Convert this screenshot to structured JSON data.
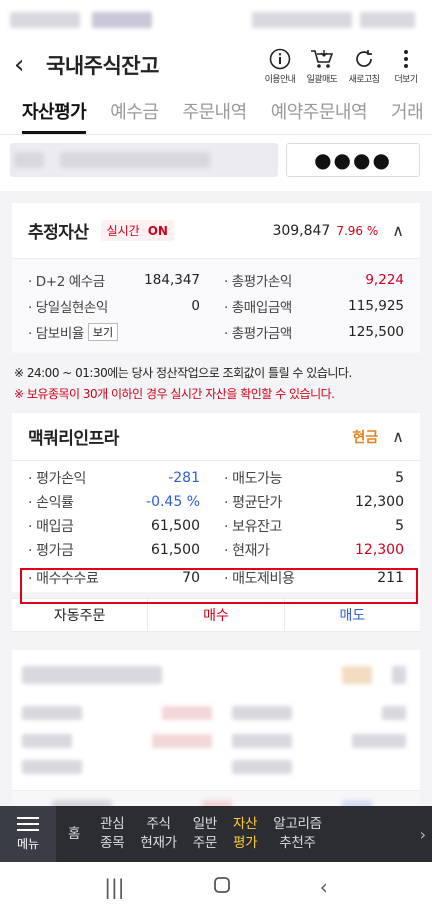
{
  "header": {
    "title": "국내주식잔고"
  },
  "tools": [
    {
      "icon": "info-icon",
      "label": "이용안내"
    },
    {
      "icon": "cart-sell-icon",
      "label": "일괄매도"
    },
    {
      "icon": "refresh-icon",
      "label": "새로고침"
    },
    {
      "icon": "more-icon",
      "label": "더보기"
    }
  ],
  "tabs": [
    "자산평가",
    "예수금",
    "주문내역",
    "예약주문내역",
    "거래"
  ],
  "account": {
    "password_mask": "●●●●"
  },
  "estimated": {
    "title": "추정자산",
    "realtime_label": "실시간",
    "realtime_state": "ON",
    "amount": "309,847",
    "rate": "7.96 %",
    "rows": [
      {
        "k": "· D+2 예수금",
        "v": "184,347"
      },
      {
        "k": "· 총평가손익",
        "v": "9,224"
      },
      {
        "k": "· 당일실현손익",
        "v": "0"
      },
      {
        "k": "· 총매입금액",
        "v": "115,925"
      },
      {
        "k": "· 담보비율",
        "btn": "보기",
        "v": ""
      },
      {
        "k": "· 총평가금액",
        "v": "125,500"
      }
    ]
  },
  "notice": {
    "line1": "※ 24:00 ~ 01:30에는 당사 정산작업으로 조회값이 틀릴 수 있습니다.",
    "line2": "※ 보유종목이 30개 이하인 경우 실시간 자산을 확인할 수 있습니다."
  },
  "stock": {
    "name": "맥쿼리인프라",
    "type": "현금",
    "rows": [
      {
        "k": "· 평가손익",
        "v": "-281"
      },
      {
        "k": "· 매도가능",
        "v": "5"
      },
      {
        "k": "· 손익률",
        "v": "-0.45 %"
      },
      {
        "k": "· 평균단가",
        "v": "12,300"
      },
      {
        "k": "· 매입금",
        "v": "61,500"
      },
      {
        "k": "· 보유잔고",
        "v": "5"
      },
      {
        "k": "· 평가금",
        "v": "61,500"
      },
      {
        "k": "· 현재가",
        "v": "12,300"
      },
      {
        "k": "· 매수수수료",
        "v": "70"
      },
      {
        "k": "· 매도제비용",
        "v": "211"
      }
    ],
    "actions": {
      "auto": "자동주문",
      "buy": "매수",
      "sell": "매도"
    }
  },
  "bottom_nav": {
    "menu": "메뉴",
    "items": [
      "홈",
      "관심\n종목",
      "주식\n현재가",
      "일반\n주문",
      "자산\n평가",
      "알고리즘\n추천주"
    ]
  },
  "colors": {
    "up": "#d0021b",
    "down": "#2e5cd6",
    "accent": "#ffcc33",
    "highlight": "#e0001a"
  }
}
